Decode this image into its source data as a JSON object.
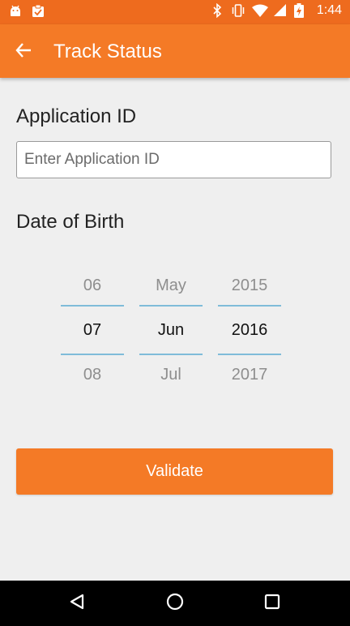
{
  "status_bar": {
    "time": "1:44",
    "left_icons": [
      "android-icon",
      "clipboard-check-icon"
    ],
    "right_icons": [
      "bluetooth-icon",
      "vibrate-icon",
      "wifi-icon",
      "signal-icon",
      "battery-charging-icon"
    ]
  },
  "app_bar": {
    "title": "Track Status",
    "back_icon": "arrow-left-icon"
  },
  "form": {
    "application_id": {
      "label": "Application ID",
      "placeholder": "Enter Application ID",
      "value": ""
    },
    "date_of_birth": {
      "label": "Date of Birth",
      "day": {
        "prev": "06",
        "selected": "07",
        "next": "08"
      },
      "month": {
        "prev": "May",
        "selected": "Jun",
        "next": "Jul"
      },
      "year": {
        "prev": "2015",
        "selected": "2016",
        "next": "2017"
      }
    },
    "validate_label": "Validate"
  },
  "nav_bar": {
    "icons": [
      "back-triangle-icon",
      "home-circle-icon",
      "recents-square-icon"
    ]
  },
  "colors": {
    "status_bar": "#ee6b1e",
    "app_bar": "#f47a26",
    "accent_line": "#7fbcd9",
    "background": "#efefef"
  }
}
